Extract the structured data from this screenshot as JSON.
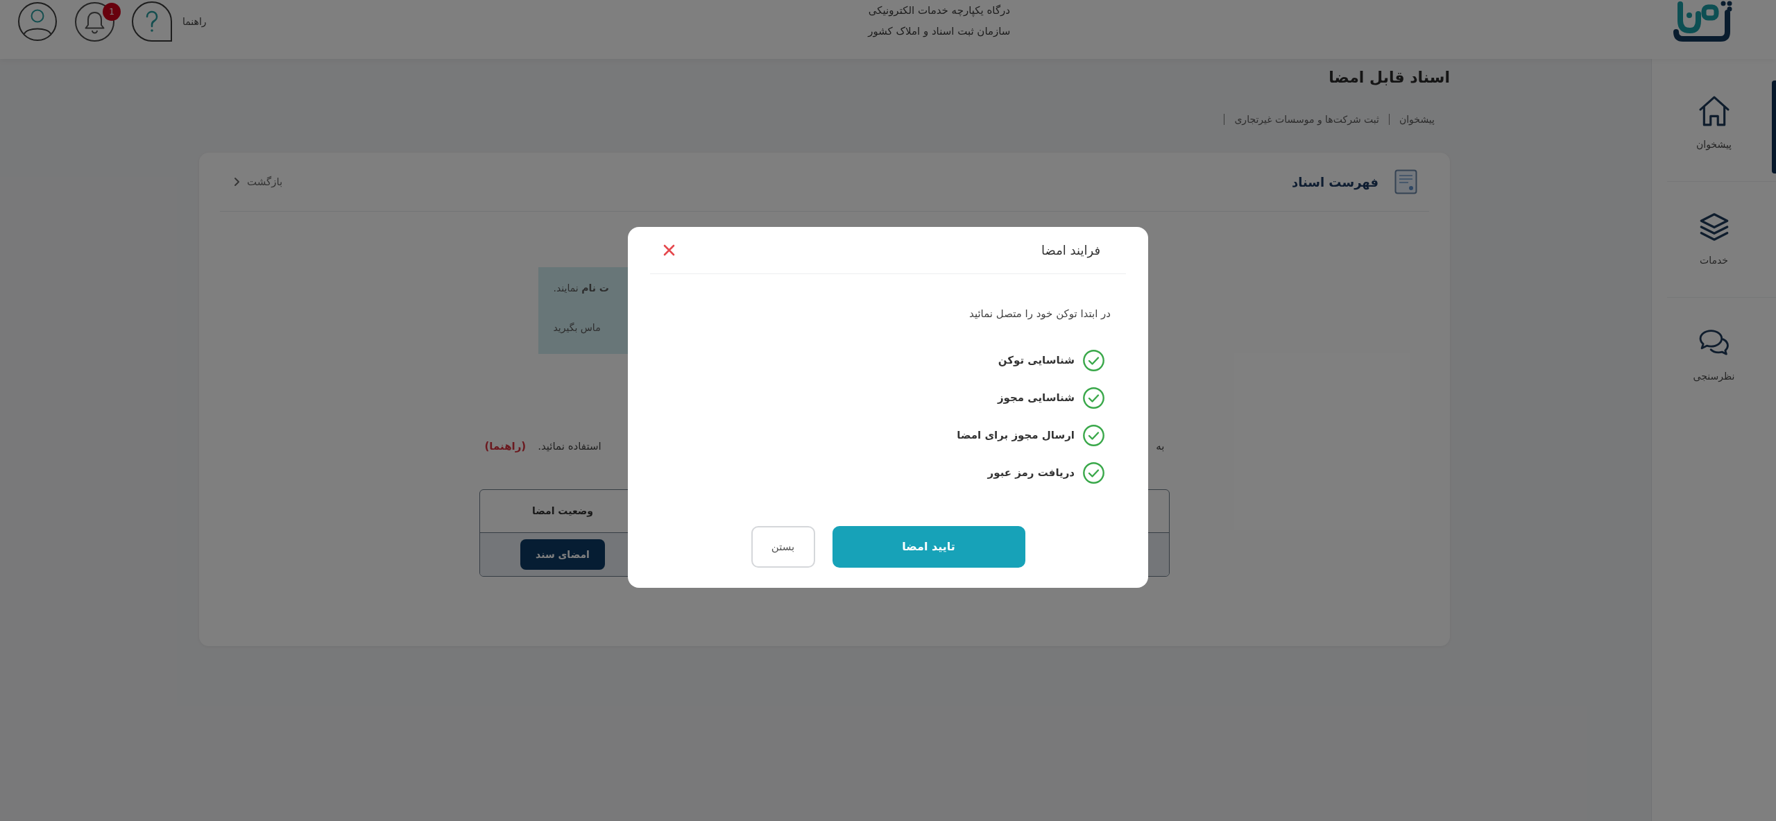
{
  "header": {
    "title": "درگاه یکپارچه خدمات الکترونیکی",
    "subtitle": "سازمان ثبت اسناد و املاک کشور",
    "help_label": "راهنما",
    "notification_count": "1"
  },
  "sidebar": {
    "items": [
      {
        "label": "پیشخوان",
        "selected": true
      },
      {
        "label": "خدمات",
        "selected": false
      },
      {
        "label": "نظرسنجی",
        "selected": false
      }
    ]
  },
  "page": {
    "title": "اسناد قابل امضا",
    "breadcrumbs": [
      "پیشخوان",
      "ثبت شرکت‌ها و موسسات غیرتجاری"
    ]
  },
  "card": {
    "title": "فهرست اسناد",
    "back_link": "بازگشت",
    "alert": {
      "lines": [
        "**ت نام** نمایند.",
        "ماس بگیرید"
      ]
    },
    "instruction": {
      "start": "به",
      "end": "استفاده نمائید.",
      "link": "(راهنما)"
    },
    "table": {
      "columns": [
        "وضعیت امضا"
      ],
      "rows": [
        {
          "action": "امضای سند"
        }
      ]
    }
  },
  "modal": {
    "title": "فرایند امضا",
    "intro": "در ابتدا توکن خود را متصل نمائید",
    "steps": [
      {
        "label": "شناسایی توکن",
        "done": true
      },
      {
        "label": "شناسایی مجوز",
        "done": true
      },
      {
        "label": "ارسال مجوز برای امضا",
        "done": true
      },
      {
        "label": "دریافت رمز عبور",
        "done": true
      }
    ],
    "buttons": [
      {
        "label": "تایید امضا",
        "kind": "primary"
      },
      {
        "label": "بستن",
        "kind": "secondary"
      }
    ]
  }
}
